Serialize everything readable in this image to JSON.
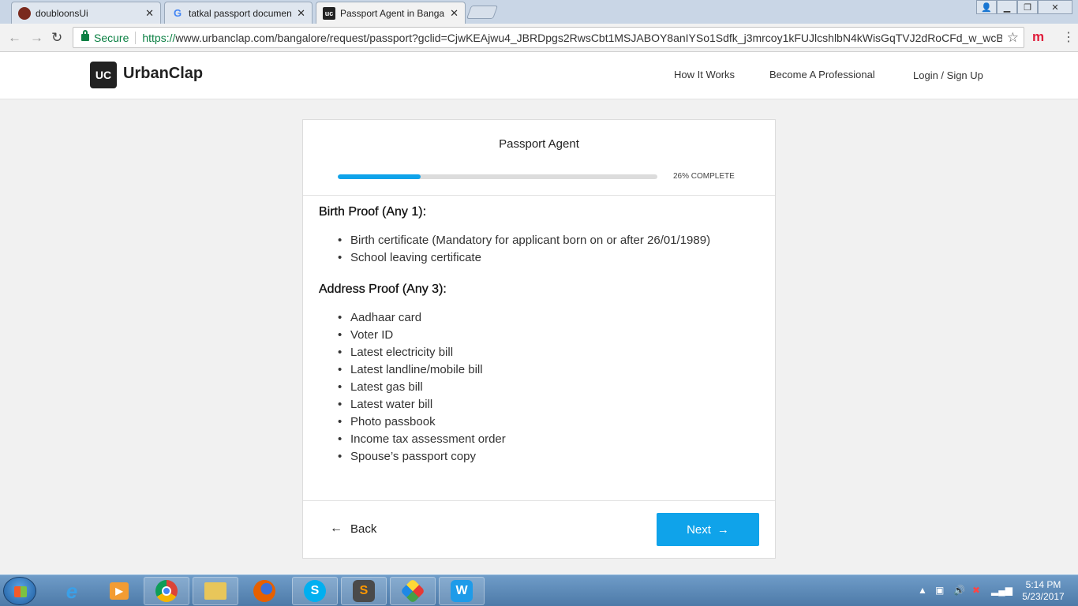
{
  "browser": {
    "tabs": [
      {
        "title": "doubloonsUi",
        "active": false
      },
      {
        "title": "tatkal passport documen",
        "active": false
      },
      {
        "title": "Passport Agent in Banga",
        "active": true
      }
    ],
    "secure_label": "Secure",
    "url_scheme": "https://",
    "url_rest": "www.urbanclap.com/bangalore/request/passport?gclid=CjwKEAjwu4_JBRDpgs2RwsCbt1MSJABOY8anIYSo1Sdfk_j3mrcoy1kFUJlcshlbN4kWisGqTVJ2dRoCFd_w_wcB&utm_",
    "extension_label": "m"
  },
  "site": {
    "logo_mark": "UC",
    "logo_text": "UrbanClap",
    "nav": [
      "How It Works",
      "Become A Professional",
      "Login / Sign Up"
    ]
  },
  "card": {
    "title": "Passport Agent",
    "progress_percent": 26,
    "progress_label": "26% COMPLETE",
    "sections": [
      {
        "heading": "Birth Proof (Any 1):",
        "items": [
          "Birth certificate (Mandatory for applicant born on or after 26/01/1989)",
          "School leaving certificate"
        ]
      },
      {
        "heading": "Address Proof (Any 3):",
        "items": [
          "Aadhaar card",
          "Voter ID",
          "Latest electricity bill",
          "Latest landline/mobile bill",
          "Latest gas bill",
          "Latest water bill",
          "Photo passbook",
          "Income tax assessment order",
          "Spouse’s passport copy"
        ]
      }
    ],
    "back_label": "Back",
    "next_label": "Next"
  },
  "taskbar": {
    "time": "5:14 PM",
    "date": "5/23/2017"
  },
  "colors": {
    "accent": "#0fa3ea",
    "secure_green": "#0b8043"
  }
}
